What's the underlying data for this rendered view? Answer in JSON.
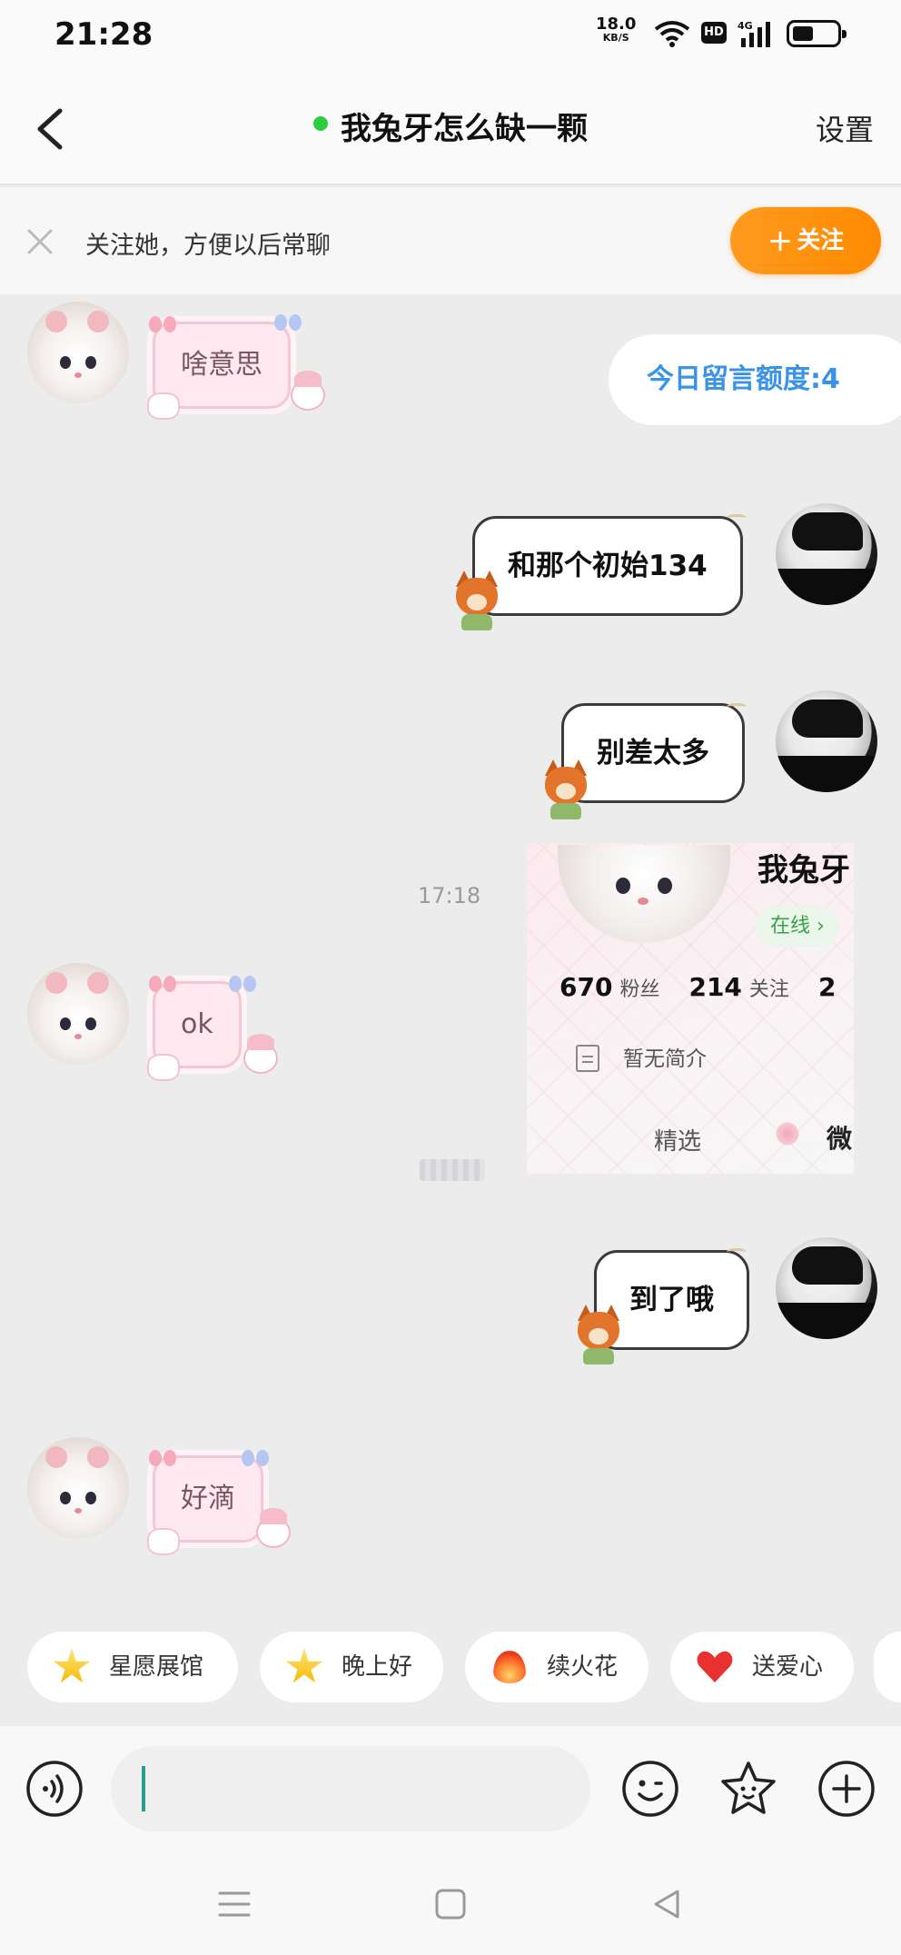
{
  "status_bar": {
    "time": "21:28",
    "net_speed": "18.0",
    "net_speed_unit": "KB/S",
    "hd_label": "HD",
    "network_type": "4G"
  },
  "header": {
    "title": "我兔牙怎么缺一颗",
    "settings_label": "设置",
    "online": true
  },
  "follow_banner": {
    "text": "关注她，方便以后常聊",
    "button_label": "关注",
    "button_color": "#ff9a1f"
  },
  "quota_label": "今日留言额度:4",
  "messages": [
    {
      "side": "in",
      "text": "啥意思"
    },
    {
      "side": "out",
      "text": "和那个初始134"
    },
    {
      "side": "out",
      "text": "别差太多"
    },
    {
      "side": "in",
      "text": "ok"
    },
    {
      "side": "out",
      "text": "到了哦"
    },
    {
      "side": "in",
      "text": "好滴"
    }
  ],
  "timestamp": "17:18",
  "profile_card": {
    "name": "我兔牙",
    "online_label": "在线 ›",
    "fans_count": "670",
    "fans_label": "粉丝",
    "following_count": "214",
    "following_label": "关注",
    "third_count": "2",
    "bio": "暂无简介",
    "tab_featured": "精选",
    "tab_partial": "微"
  },
  "quick_actions": [
    {
      "label": "星愿展馆",
      "icon": "star-icon"
    },
    {
      "label": "晚上好",
      "icon": "star-icon"
    },
    {
      "label": "续火花",
      "icon": "flame-icon"
    },
    {
      "label": "送爱心",
      "icon": "heart-icon"
    }
  ],
  "input": {
    "value": "",
    "placeholder": ""
  },
  "colors": {
    "accent_orange": "#ff8a00",
    "online_green": "#2ecc40",
    "quota_blue": "#3a93e6"
  }
}
